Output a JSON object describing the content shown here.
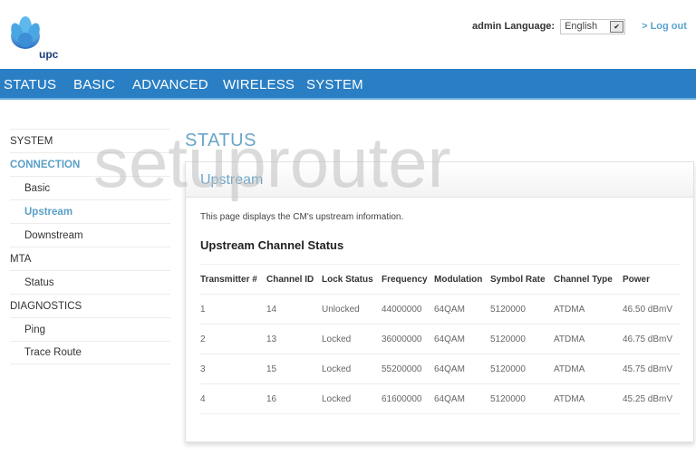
{
  "header": {
    "logo_text": "upc",
    "user_label": "admin",
    "language_label": "Language:",
    "language_selected": "English",
    "logout_label": "> Log out"
  },
  "nav": {
    "items": [
      {
        "label": "STATUS"
      },
      {
        "label": "BASIC"
      },
      {
        "label": "ADVANCED"
      },
      {
        "label": "WIRELESS"
      },
      {
        "label": "SYSTEM"
      }
    ]
  },
  "sidebar": {
    "items": [
      {
        "label": "SYSTEM"
      },
      {
        "label": "CONNECTION"
      },
      {
        "label": "Basic"
      },
      {
        "label": "Upstream"
      },
      {
        "label": "Downstream"
      },
      {
        "label": "MTA"
      },
      {
        "label": "Status"
      },
      {
        "label": "DIAGNOSTICS"
      },
      {
        "label": "Ping"
      },
      {
        "label": "Trace Route"
      }
    ]
  },
  "page": {
    "title": "STATUS",
    "panel_title": "Upstream",
    "description": "This page displays the CM's upstream information.",
    "section_title": "Upstream Channel Status"
  },
  "table": {
    "headers": [
      "Transmitter #",
      "Channel ID",
      "Lock Status",
      "Frequency",
      "Modulation",
      "Symbol Rate",
      "Channel Type",
      "Power"
    ],
    "rows": [
      [
        "1",
        "14",
        "Unlocked",
        "44000000",
        "64QAM",
        "5120000",
        "ATDMA",
        "46.50 dBmV"
      ],
      [
        "2",
        "13",
        "Locked",
        "36000000",
        "64QAM",
        "5120000",
        "ATDMA",
        "46.75 dBmV"
      ],
      [
        "3",
        "15",
        "Locked",
        "55200000",
        "64QAM",
        "5120000",
        "ATDMA",
        "45.75 dBmV"
      ],
      [
        "4",
        "16",
        "Locked",
        "61600000",
        "64QAM",
        "5120000",
        "ATDMA",
        "45.25 dBmV"
      ]
    ]
  },
  "watermark": "setuprouter",
  "colors": {
    "nav_bg": "#2a7fc4",
    "accent": "#6aa5c8",
    "active_sidebar": "#5a9fc8",
    "logout": "#5aa3d0"
  }
}
